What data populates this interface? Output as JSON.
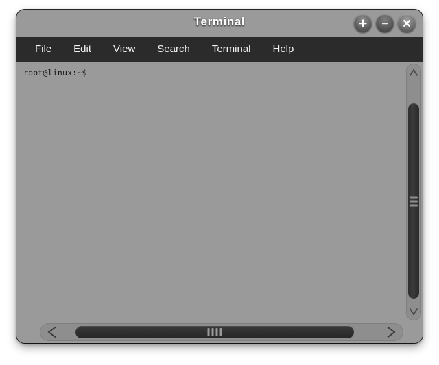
{
  "window": {
    "title": "Terminal",
    "controls": [
      {
        "name": "maximize",
        "icon": "plus-icon",
        "symbol": "+"
      },
      {
        "name": "minimize",
        "icon": "minus-icon",
        "symbol": "−"
      },
      {
        "name": "close",
        "icon": "close-icon",
        "symbol": "×"
      }
    ]
  },
  "menubar": {
    "items": [
      {
        "label": "File"
      },
      {
        "label": "Edit"
      },
      {
        "label": "View"
      },
      {
        "label": "Search"
      },
      {
        "label": "Terminal"
      },
      {
        "label": "Help"
      }
    ]
  },
  "terminal": {
    "prompt": "root@linux:~$",
    "lines": [
      "root@linux:~$"
    ],
    "background_color": "#9a9a9a",
    "text_color": "#141414"
  },
  "scrollbars": {
    "vertical": {
      "up_icon": "chevron-up-icon",
      "down_icon": "chevron-down-icon",
      "grip_lines": 3
    },
    "horizontal": {
      "left_icon": "chevron-left-icon",
      "right_icon": "chevron-right-icon",
      "grip_lines": 4
    }
  },
  "colors": {
    "titlebar": "#000000",
    "menubar": "#2b2b2b",
    "terminal_bg": "#9a9a9a",
    "scroll_trough": "#8e8e8e",
    "scroll_thumb": "#2f2f2f",
    "desktop": "#ffffff"
  }
}
